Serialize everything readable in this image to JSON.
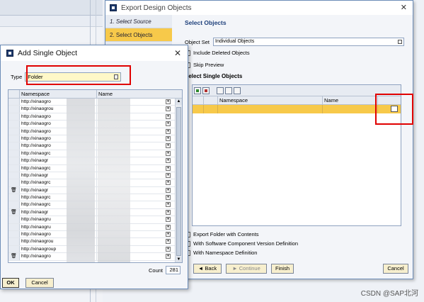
{
  "export_dialog": {
    "title": "Export Design Objects",
    "steps": [
      {
        "label": "1. Select Source"
      },
      {
        "label": "2. Select Objects"
      }
    ],
    "heading": "Select Objects",
    "object_set_label": "Object Set",
    "object_set_value": "Individual Objects",
    "include_deleted_label": "Include Deleted Objects",
    "skip_preview_label": "Skip Preview",
    "select_single_heading": "Select Single Objects",
    "columns": {
      "namespace": "Namespace",
      "name": "Name"
    },
    "export_folder_label": "Export Folder with Contents",
    "with_swcv_label": "With Software Component Version Definition",
    "with_namespace_label": "With Namespace Definition",
    "buttons": {
      "back": "◄ Back",
      "continue": "► Continue",
      "finish": "Finish",
      "cancel": "Cancel"
    }
  },
  "add_single_object": {
    "title": "Add Single Object",
    "type_label": "Type",
    "type_value": "Folder",
    "columns": {
      "namespace": "Namespace",
      "name": "Name"
    },
    "rows": [
      {
        "ns": "http://xinaogro",
        "icon": ""
      },
      {
        "ns": "http://xinaogrou",
        "icon": ""
      },
      {
        "ns": "http://xinaogro",
        "icon": ""
      },
      {
        "ns": "http://xinaogro",
        "icon": ""
      },
      {
        "ns": "http://xinaogro",
        "icon": ""
      },
      {
        "ns": "http://xinaogro",
        "icon": ""
      },
      {
        "ns": "http://xinaogro",
        "icon": ""
      },
      {
        "ns": "http://xinaogrc",
        "icon": ""
      },
      {
        "ns": "http://xinaogr",
        "icon": ""
      },
      {
        "ns": "http://xinaogrc",
        "icon": ""
      },
      {
        "ns": "http://xinaogr",
        "icon": ""
      },
      {
        "ns": "http://xinaogrc",
        "icon": ""
      },
      {
        "ns": "http://xinaogr",
        "icon": "trash"
      },
      {
        "ns": "http://xinaogrc",
        "icon": ""
      },
      {
        "ns": "http://xinaogrc",
        "icon": ""
      },
      {
        "ns": "http://xinaogr",
        "icon": "trash"
      },
      {
        "ns": "http://xinaogru",
        "icon": ""
      },
      {
        "ns": "http://xinaogru",
        "icon": ""
      },
      {
        "ns": "http://xinaogro",
        "icon": ""
      },
      {
        "ns": "http://xinaogrou",
        "icon": ""
      },
      {
        "ns": "http://xinaogroup",
        "icon": ""
      },
      {
        "ns": "http://xinaogro",
        "icon": "trash"
      }
    ],
    "count_label": "Count",
    "count_value": "281",
    "ok_label": "OK",
    "cancel_label": "Cancel"
  },
  "watermark": "CSDN @SAP北河"
}
